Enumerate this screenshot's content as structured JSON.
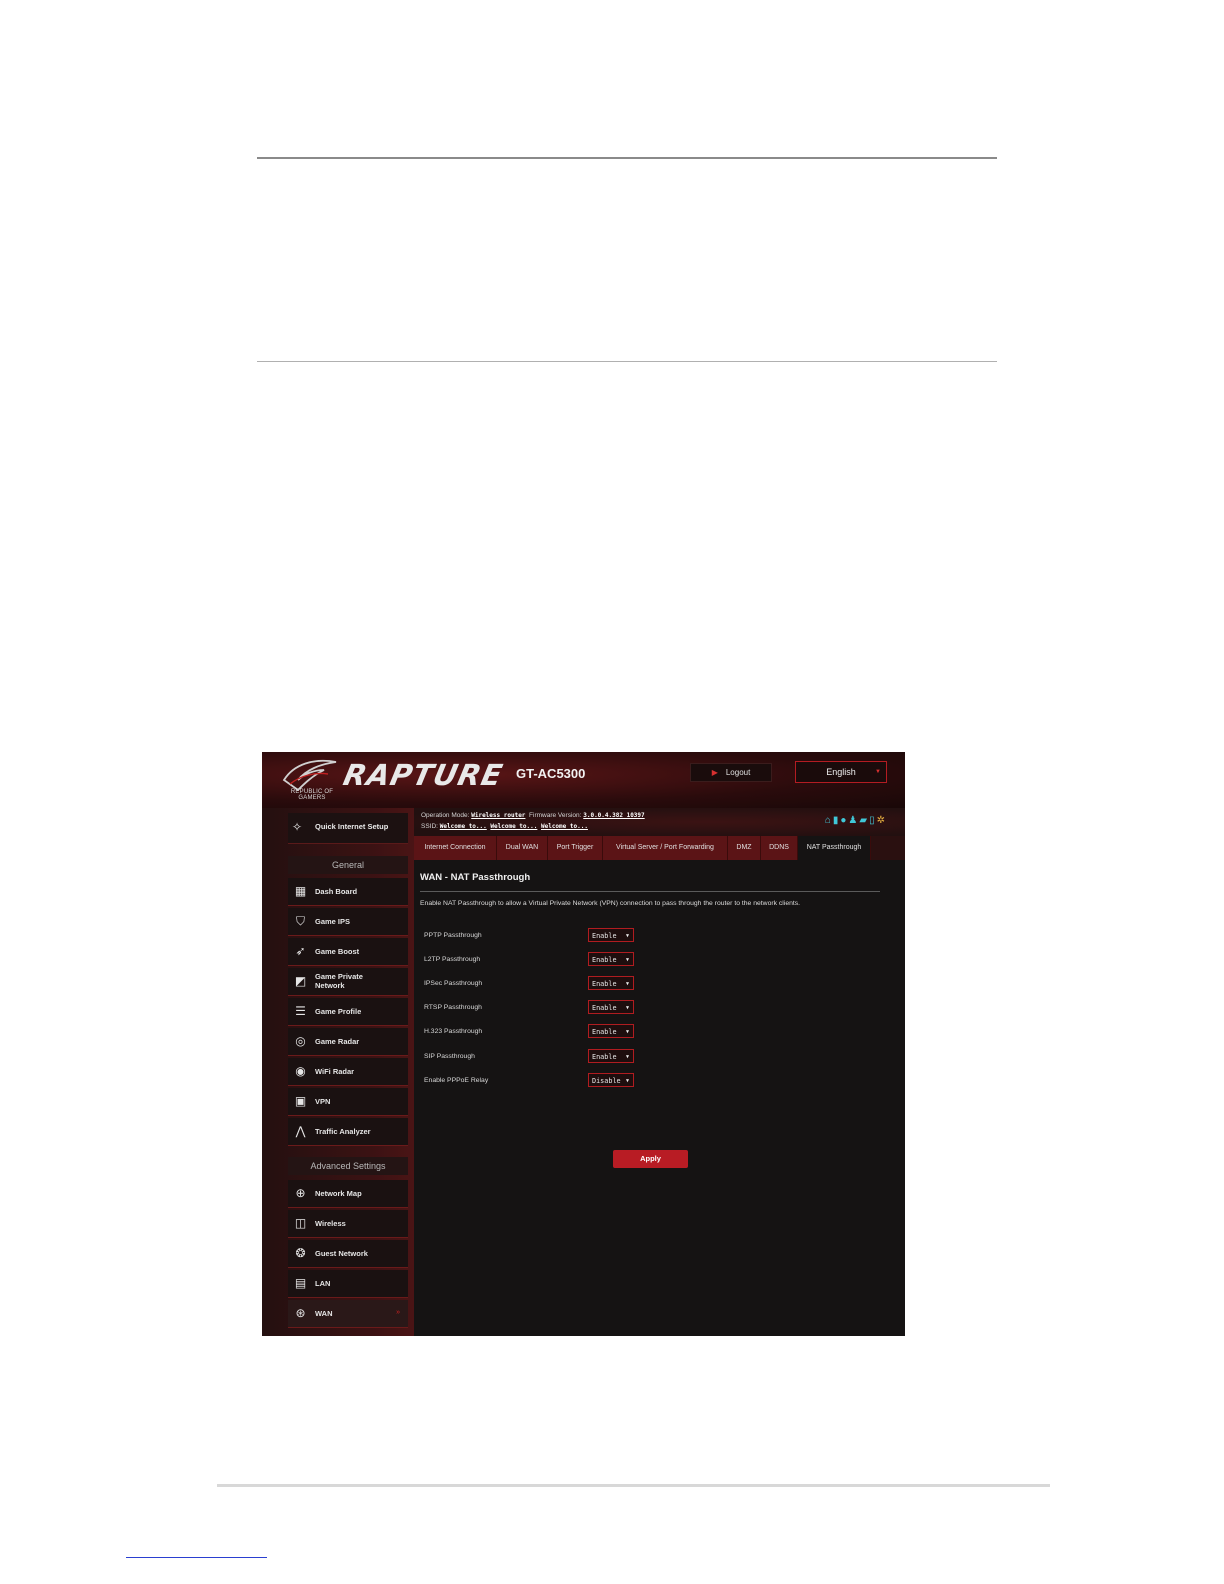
{
  "header": {
    "logo_text": "REPUBLIC OF GAMERS",
    "brand": "RAPTURE",
    "model": "GT-AC5300",
    "logout_label": "Logout",
    "language": "English"
  },
  "info": {
    "operation_mode_label": "Operation Mode:",
    "operation_mode_value": "Wireless router",
    "firmware_label": "Firmware Version:",
    "firmware_value": "3.0.0.4.382_10397",
    "ssid_label": "SSID:",
    "ssid_values": [
      "Welcome to...",
      "Welcome to...",
      "Welcome to..."
    ]
  },
  "sidebar": {
    "quick_setup": "Quick Internet Setup",
    "general_title": "General",
    "general_items": [
      {
        "label": "Dash Board",
        "icon": "dashboard-icon"
      },
      {
        "label": "Game IPS",
        "icon": "shield-icon"
      },
      {
        "label": "Game Boost",
        "icon": "rocket-icon"
      },
      {
        "label": "Game Private Network",
        "icon": "private-network-icon"
      },
      {
        "label": "Game Profile",
        "icon": "profile-icon"
      },
      {
        "label": "Game Radar",
        "icon": "radar-icon"
      },
      {
        "label": "WiFi Radar",
        "icon": "wifi-radar-icon"
      },
      {
        "label": "VPN",
        "icon": "vpn-icon"
      },
      {
        "label": "Traffic Analyzer",
        "icon": "traffic-icon"
      }
    ],
    "advanced_title": "Advanced Settings",
    "advanced_items": [
      {
        "label": "Network Map",
        "icon": "network-map-icon"
      },
      {
        "label": "Wireless",
        "icon": "wireless-icon"
      },
      {
        "label": "Guest Network",
        "icon": "guest-network-icon"
      },
      {
        "label": "LAN",
        "icon": "lan-icon"
      },
      {
        "label": "WAN",
        "icon": "globe-icon"
      }
    ]
  },
  "tabs": [
    "Internet Connection",
    "Dual WAN",
    "Port Trigger",
    "Virtual Server / Port Forwarding",
    "DMZ",
    "DDNS",
    "NAT Passthrough"
  ],
  "page": {
    "title": "WAN - NAT Passthrough",
    "description": "Enable NAT Passthrough to allow a Virtual Private Network (VPN) connection to pass through the router to the network clients.",
    "settings": [
      {
        "label": "PPTP Passthrough",
        "value": "Enable"
      },
      {
        "label": "L2TP Passthrough",
        "value": "Enable"
      },
      {
        "label": "IPSec Passthrough",
        "value": "Enable"
      },
      {
        "label": "RTSP Passthrough",
        "value": "Enable"
      },
      {
        "label": "H.323 Passthrough",
        "value": "Enable"
      },
      {
        "label": "SIP Passthrough",
        "value": "Enable"
      },
      {
        "label": "Enable PPPoE Relay",
        "value": "Disable"
      }
    ],
    "apply_label": "Apply"
  },
  "colors": {
    "accent": "#b81c24",
    "background": "#151313",
    "tab_bg": "#5b1416"
  }
}
